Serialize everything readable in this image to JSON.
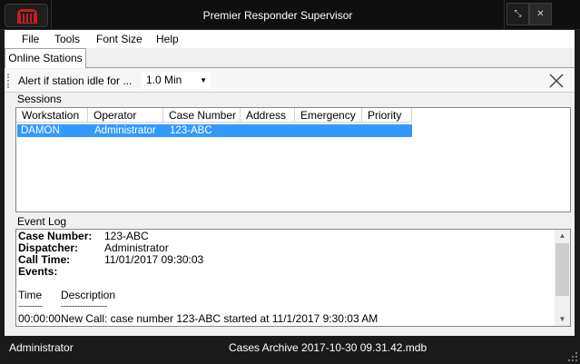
{
  "window": {
    "title": "Premier Responder Supervisor"
  },
  "title_buttons": {
    "restore": "⤡",
    "close": "✕"
  },
  "menu": [
    {
      "label": "File"
    },
    {
      "label": "Tools"
    },
    {
      "label": "Font Size"
    },
    {
      "label": "Help"
    }
  ],
  "tabs": [
    {
      "label": "Online Stations",
      "active": true
    }
  ],
  "toolbar": {
    "alert_label": "Alert if station idle for ...",
    "idle_value": "1.0 Min",
    "dropdown_arrow": "▼"
  },
  "sessions": {
    "label": "Sessions",
    "columns": [
      "Workstation",
      "Operator",
      "Case Number",
      "Address",
      "Emergency",
      "Priority"
    ],
    "rows": [
      {
        "workstation": "DAMON",
        "operator": "Administrator",
        "case_number": "123-ABC",
        "address": "",
        "emergency": "",
        "priority": "",
        "selected": true
      }
    ]
  },
  "event_log": {
    "label": "Event Log",
    "fields": [
      {
        "key": "Case Number:",
        "value": "123-ABC"
      },
      {
        "key": "Dispatcher:",
        "value": "Administrator"
      },
      {
        "key": "Call Time:",
        "value": "11/01/2017 09:30:03"
      },
      {
        "key": "Events:",
        "value": ""
      }
    ],
    "table_header": {
      "time": "Time",
      "description": "Description"
    },
    "separators": {
      "time": "---------",
      "description": "-----------------"
    },
    "entries": [
      {
        "time": "00:00:00",
        "description": "New Call: case number 123-ABC started at 11/1/2017 9:30:03 AM"
      }
    ],
    "scroll_up": "▲",
    "scroll_down": "▼"
  },
  "status_bar": {
    "user": "Administrator",
    "database": "Cases Archive 2017-10-30 09.31.42.mdb"
  },
  "colors": {
    "selection": "#3399ff",
    "title_bar": "#0f0f0f",
    "app_icon": "#c41e1e"
  }
}
